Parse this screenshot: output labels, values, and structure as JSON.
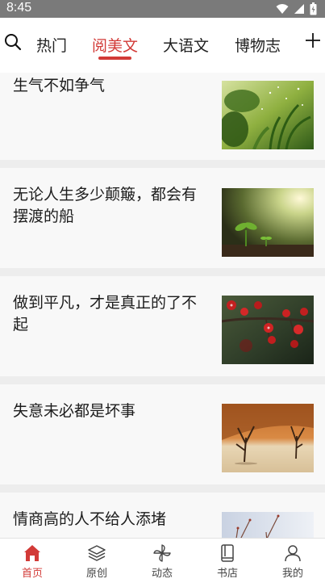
{
  "status_bar": {
    "time": "8:45",
    "icons": [
      "wifi-icon",
      "signal-icon",
      "battery-icon"
    ]
  },
  "top_nav": {
    "search_icon": "search-icon",
    "add_icon": "plus-icon",
    "tabs": [
      {
        "label": "热门",
        "active": false
      },
      {
        "label": "阅美文",
        "active": true
      },
      {
        "label": "大语文",
        "active": false
      },
      {
        "label": "博物志",
        "active": false
      }
    ]
  },
  "feed": {
    "articles": [
      {
        "title": "生气不如争气",
        "image": "green-plants-rain-photo"
      },
      {
        "title": "无论人生多少颠簸，都会有摆渡的船",
        "image": "seedling-sunlight-photo"
      },
      {
        "title": "做到平凡，才是真正的了不起",
        "image": "red-berries-branch-photo"
      },
      {
        "title": "失意未必都是坏事",
        "image": "desert-dead-trees-photo"
      },
      {
        "title": "情商高的人不给人添堵",
        "image": "snowy-branches-photo"
      }
    ]
  },
  "bottom_nav": {
    "items": [
      {
        "label": "首页",
        "icon": "home-icon",
        "active": true
      },
      {
        "label": "原创",
        "icon": "layers-icon",
        "active": false
      },
      {
        "label": "动态",
        "icon": "pinwheel-icon",
        "active": false
      },
      {
        "label": "书店",
        "icon": "book-icon",
        "active": false
      },
      {
        "label": "我的",
        "icon": "profile-icon",
        "active": false
      }
    ]
  },
  "colors": {
    "accent": "#d23a37",
    "status_bar": "#7a7a7a",
    "card_bg": "#f8f8f8",
    "separator": "#ededed"
  }
}
